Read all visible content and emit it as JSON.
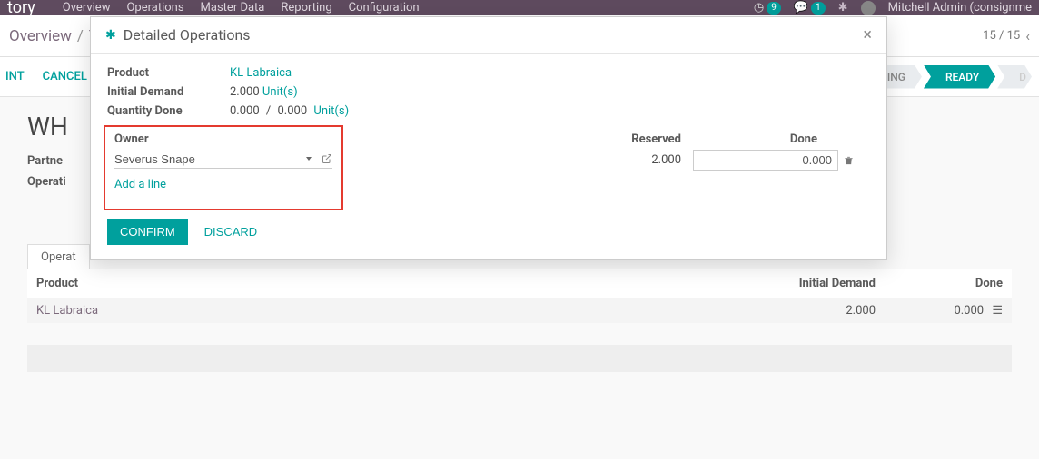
{
  "topbar": {
    "app_fragment": "tory",
    "nav": [
      "Overview",
      "Operations",
      "Master Data",
      "Reporting",
      "Configuration"
    ],
    "clock_badge": "9",
    "chat_badge": "1",
    "user": "Mitchell Admin (consignme"
  },
  "breadcrumb": {
    "items": [
      "Overview",
      "Yo"
    ],
    "counter": "15 / 15"
  },
  "actions": {
    "print": "INT",
    "cancel": "CANCEL"
  },
  "status": {
    "waiting": "WAITING",
    "ready": "READY",
    "done_frag": "D"
  },
  "record": {
    "title": "WH",
    "partner_label": "Partne",
    "operation_label": "Operati"
  },
  "tabs": {
    "operations": "Operat"
  },
  "grid": {
    "headers": {
      "product": "Product",
      "initial": "Initial Demand",
      "done": "Done"
    },
    "rows": [
      {
        "product": "KL Labraica",
        "initial": "2.000",
        "done": "0.000"
      }
    ]
  },
  "modal": {
    "title": "Detailed Operations",
    "product_label": "Product",
    "product_value": "KL Labraica",
    "initial_label": "Initial Demand",
    "initial_value": "2.000",
    "initial_unit": "Unit(s)",
    "qty_label": "Quantity Done",
    "qty_done": "0.000",
    "qty_sep": "/",
    "qty_total": "0.000",
    "qty_unit": "Unit(s)",
    "owner_header": "Owner",
    "reserved_header": "Reserved",
    "done_header": "Done",
    "owner_value": "Severus Snape",
    "reserved_value": "2.000",
    "done_value": "0.000",
    "add_line": "Add a line",
    "confirm": "CONFIRM",
    "discard": "DISCARD"
  }
}
